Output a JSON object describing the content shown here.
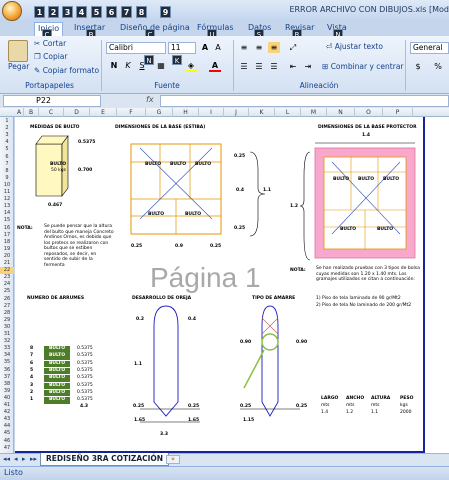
{
  "window": {
    "title": "ERROR ARCHIVO CON DIBUJOS.xls [Mod",
    "quick_access_keys": [
      "1",
      "2",
      "3",
      "4",
      "5",
      "6",
      "7",
      "8",
      "9"
    ]
  },
  "tabs": [
    {
      "label": "Inicio",
      "key": "C"
    },
    {
      "label": "Insertar",
      "key": "B"
    },
    {
      "label": "Diseño de página",
      "key": "C"
    },
    {
      "label": "Fórmulas",
      "key": "U"
    },
    {
      "label": "Datos",
      "key": "S"
    },
    {
      "label": "Revisar",
      "key": "R"
    },
    {
      "label": "Vista",
      "key": "N"
    }
  ],
  "ribbon": {
    "paste": "Pegar",
    "cut": "Cortar",
    "copy": "Copiar",
    "format_painter": "Copiar formato",
    "font_name": "Calibri",
    "font_size": "11",
    "bold": "N",
    "italic": "K",
    "underline": "S",
    "wrap_text": "Ajustar texto",
    "merge_center": "Combinar y centrar",
    "number_format": "General",
    "currency": "$",
    "percent": "%",
    "groups": {
      "clipboard": "Portapapeles",
      "font": "Fuente",
      "alignment": "Alineación"
    },
    "font_color_hex": "#ff0000",
    "fill_color_hex": "#ffff00"
  },
  "formula_bar": {
    "cell_ref": "P22",
    "fx": "fx",
    "value": ""
  },
  "columns": [
    "A",
    "B",
    "C",
    "D",
    "E",
    "F",
    "G",
    "H",
    "I",
    "J",
    "K",
    "L",
    "M",
    "N",
    "O",
    "P"
  ],
  "rows": [
    "1",
    "2",
    "3",
    "4",
    "5",
    "6",
    "7",
    "8",
    "9",
    "10",
    "11",
    "12",
    "13",
    "14",
    "15",
    "16",
    "17",
    "18",
    "19",
    "20",
    "21",
    "22",
    "23",
    "24",
    "25",
    "26",
    "27",
    "28",
    "29",
    "30",
    "31",
    "32",
    "33",
    "34",
    "35",
    "36",
    "37",
    "38",
    "39",
    "40",
    "41",
    "42",
    "43",
    "44",
    "45",
    "46",
    "47"
  ],
  "sheet": {
    "box_title": "MEDIDAS DE BULTO",
    "box_label": "BULTO",
    "box_weight": "50 kgs",
    "dim_side": "0.5375",
    "dim_height": "0.700",
    "dim_bottom": "0.467",
    "base_title": "DIMENSIONES DE LA BASE (ESTIBA)",
    "base_dims": [
      "0.25",
      "0.4",
      "0.25"
    ],
    "base_bottom": [
      "0.25",
      "0.9",
      "0.25"
    ],
    "base_total": "1.1",
    "protected_title": "DIMENSIONES DE LA BASE PROTECTOR",
    "protected_top": "1.4",
    "protected_side": "1.2",
    "bulto_labels": [
      "BULTO",
      "BULTO",
      "BULTO",
      "BULTO",
      "BULTO",
      "BULTO"
    ],
    "note_label": "NOTA:",
    "note_text": "Se puede pensar que la altura del bulto que maneja Concreto Andinos Ornos, es debido que los protecs se realizaron con bultos que se estiben reposados, se decir, en sentido de subir de la fermenta",
    "note2_label": "NOTA:",
    "note2_text": "Se han realizado pruebas con 3 tipos de bolsa cuyas medidas son 1.20 x 1.40 mts. Los gramajes utilizados se citan a continuación:",
    "note2_item1": "1) Piso de tela laminado de 90 gr/Mt2",
    "note2_item2": "2) Piso de tela No laminado de 200 gr/Mt2",
    "arrumes_title": "NUMERO DE ARRUMES",
    "arrumes": [
      {
        "n": "8",
        "label": "BULTO",
        "v": "0.5375"
      },
      {
        "n": "7",
        "label": "BULTO",
        "v": "0.5375"
      },
      {
        "n": "6",
        "label": "BULTO",
        "v": "0.5375"
      },
      {
        "n": "5",
        "label": "BULTO",
        "v": "0.5375"
      },
      {
        "n": "4",
        "label": "BULTO",
        "v": "0.5375"
      },
      {
        "n": "3",
        "label": "BULTO",
        "v": "0.5375"
      },
      {
        "n": "2",
        "label": "BULTO",
        "v": "0.5375"
      },
      {
        "n": "1",
        "label": "BULTO",
        "v": "0.5375"
      }
    ],
    "arrumes_total": "4.3",
    "oreja_title": "DESARROLLO DE OREJA",
    "oreja_vals": [
      "0.2",
      "0.4",
      "1.1",
      "0.25",
      "0.25"
    ],
    "oreja_bottom": [
      "1.65",
      "1.65"
    ],
    "oreja_total": "3.3",
    "amarre_title": "TIPO DE AMARRE",
    "amarre_vals": [
      "0.90",
      "0.90",
      "0.25",
      "0.25"
    ],
    "amarre_bottom": "1.15",
    "spec_headers": [
      "LARGO",
      "ANCHO",
      "ALTURA",
      "PESO"
    ],
    "spec_units": [
      "mts",
      "mts",
      "mts",
      "kgs"
    ],
    "spec_values": [
      "1.4",
      "1.2",
      "1.1",
      "2000"
    ],
    "watermark": "Página 1"
  },
  "sheet_tab": "REDISEÑO 3RA COTIZACIÓN",
  "status": "Listo"
}
